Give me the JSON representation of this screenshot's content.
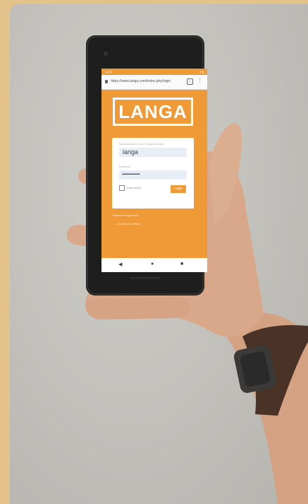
{
  "phone": {
    "status_time": "16:30",
    "status_icons": "◔ ▾ ▮",
    "browser": {
      "url": "https://www.langa.com/index.php/login",
      "tab_count": "1",
      "menu_glyph": "⋮"
    },
    "app": {
      "logo_text": "LANGA",
      "form": {
        "username_label": "Benutzername oder E-Mail-Adresse",
        "username_value": "langa",
        "password_label": "Passwort",
        "password_dots": "••••••••••••••••••••",
        "remember_label": "Angemeldet",
        "login_label": "Login"
      },
      "links": {
        "forgot_password": "Passwort vergessen?",
        "back_link": "← Zurück zu LANGA"
      }
    },
    "navbar": {
      "back": "◀",
      "home": "●",
      "recents": "■"
    }
  },
  "colors": {
    "app_orange": "#ef9a36",
    "frame": "#e3c28c",
    "wall": "#c4c2bd",
    "phone_body": "#1e1e1e",
    "skin": "#d9a88a",
    "watch_strap": "#4a3226"
  }
}
